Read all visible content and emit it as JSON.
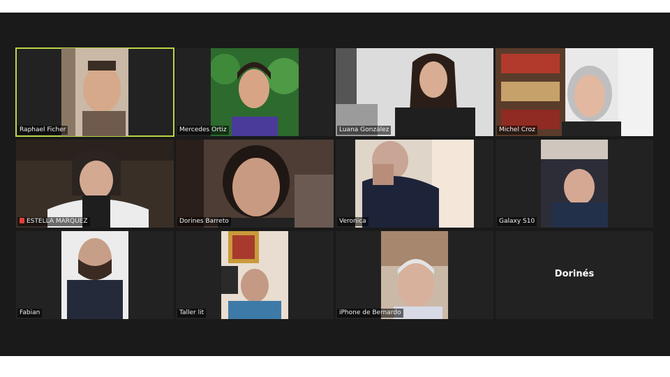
{
  "meeting": {
    "participants": [
      {
        "name": "Raphael Ficher",
        "active_speaker": true,
        "video_on": true,
        "icon": "person-video"
      },
      {
        "name": "Mercedes Ortiz",
        "active_speaker": false,
        "video_on": true,
        "icon": "person-video"
      },
      {
        "name": "Luana González",
        "active_speaker": false,
        "video_on": true,
        "icon": "person-video"
      },
      {
        "name": "Michel Croz",
        "active_speaker": false,
        "video_on": true,
        "icon": "person-video"
      },
      {
        "name": "ESTELLA MARQUEZ",
        "active_speaker": false,
        "video_on": true,
        "muted": true,
        "icon": "mic-muted-icon"
      },
      {
        "name": "Dorines Barreto",
        "active_speaker": false,
        "video_on": true,
        "icon": "person-video"
      },
      {
        "name": "Veronica",
        "active_speaker": false,
        "video_on": true,
        "icon": "person-video"
      },
      {
        "name": "Galaxy S10",
        "active_speaker": false,
        "video_on": true,
        "icon": "person-video"
      },
      {
        "name": "Fabian",
        "active_speaker": false,
        "video_on": true,
        "icon": "person-video"
      },
      {
        "name": "Taller lit",
        "active_speaker": false,
        "video_on": true,
        "icon": "person-video"
      },
      {
        "name": "iPhone de Bernardo",
        "active_speaker": false,
        "video_on": true,
        "icon": "person-video"
      },
      {
        "name": "Dorinés",
        "active_speaker": false,
        "video_on": false,
        "icon": "none"
      }
    ]
  },
  "colors": {
    "background": "#1a1a1a",
    "tile": "#222222",
    "active_speaker_border": "#b9d545",
    "name_text": "#f0f0f0"
  }
}
